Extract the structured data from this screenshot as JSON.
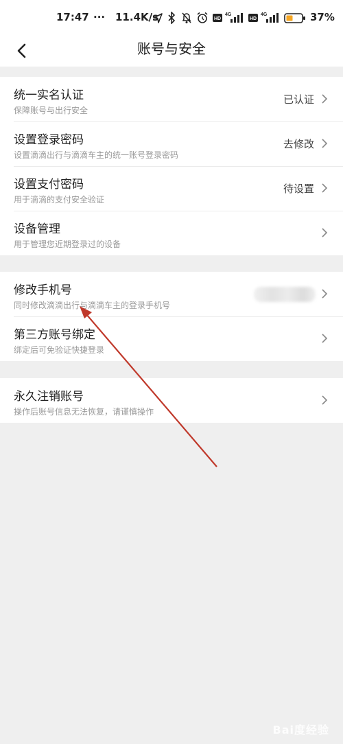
{
  "status_bar": {
    "time": "17:47",
    "dots": "···",
    "speed": "11.4K/s",
    "battery": "37%",
    "icons": [
      "location-arrow-icon",
      "bluetooth-icon",
      "mute-bell-icon",
      "alarm-icon",
      "hd-icon",
      "signal-4g-icon",
      "hd-icon",
      "signal-4g-icon",
      "battery-icon"
    ]
  },
  "nav": {
    "title": "账号与安全",
    "back_icon": "chevron-left-icon"
  },
  "groups": [
    {
      "rows": [
        {
          "title": "统一实名认证",
          "subtitle": "保障账号与出行安全",
          "value": "已认证"
        },
        {
          "title": "设置登录密码",
          "subtitle": "设置滴滴出行与滴滴车主的统一账号登录密码",
          "value": "去修改"
        },
        {
          "title": "设置支付密码",
          "subtitle": "用于滴滴的支付安全验证",
          "value": "待设置"
        },
        {
          "title": "设备管理",
          "subtitle": "用于管理您近期登录过的设备",
          "value": ""
        }
      ]
    },
    {
      "rows": [
        {
          "title": "修改手机号",
          "subtitle": "同时修改滴滴出行与滴滴车主的登录手机号",
          "value": ""
        },
        {
          "title": "第三方账号绑定",
          "subtitle": "绑定后可免验证快捷登录",
          "value": ""
        }
      ]
    },
    {
      "rows": [
        {
          "title": "永久注销账号",
          "subtitle": "操作后账号信息无法恢复，请谨慎操作",
          "value": ""
        }
      ]
    }
  ],
  "colors": {
    "annotation_arrow": "#c0392b",
    "background": "#efefef"
  },
  "watermark": "Bai度经验"
}
